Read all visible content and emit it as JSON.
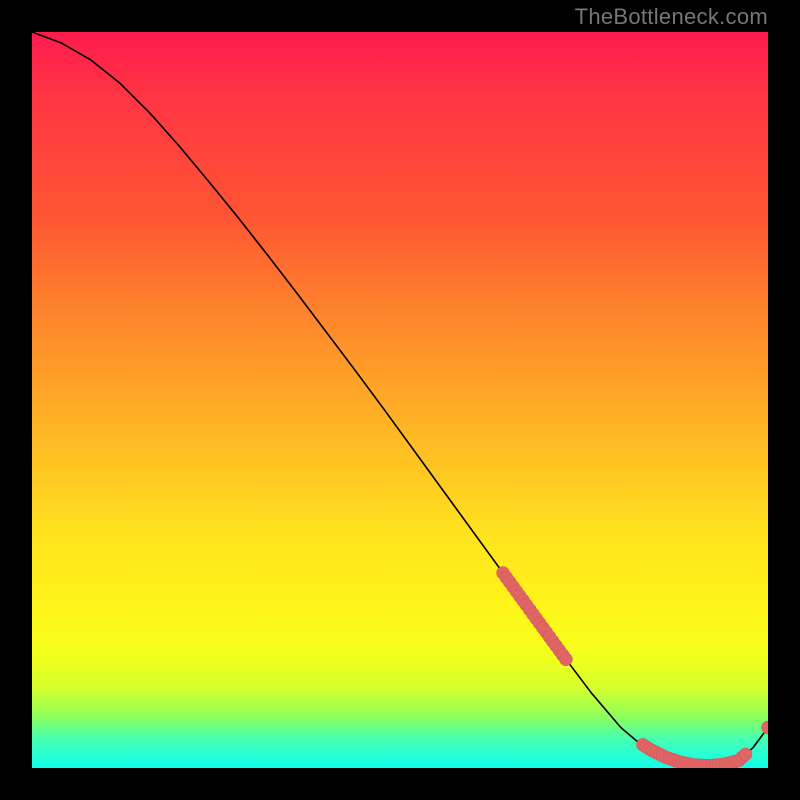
{
  "watermark": "TheBottleneck.com",
  "chart_data": {
    "type": "line",
    "title": "",
    "xlabel": "",
    "ylabel": "",
    "x_range": [
      0,
      100
    ],
    "y_range": [
      0,
      100
    ],
    "curve": {
      "name": "bottleneck-curve",
      "x": [
        0,
        4,
        8,
        12,
        16,
        20,
        24,
        28,
        32,
        36,
        40,
        44,
        48,
        52,
        56,
        60,
        64,
        68,
        72,
        76,
        80,
        82,
        84,
        86,
        88,
        90,
        92,
        94,
        96,
        98,
        100
      ],
      "y": [
        100,
        98.5,
        96.2,
        93.0,
        89.0,
        84.5,
        79.7,
        74.8,
        69.7,
        64.5,
        59.2,
        53.9,
        48.5,
        43.0,
        37.5,
        32.0,
        26.5,
        21.0,
        15.5,
        10.2,
        5.5,
        3.8,
        2.5,
        1.5,
        0.8,
        0.4,
        0.3,
        0.5,
        1.0,
        2.8,
        5.5
      ]
    },
    "highlight_regions": [
      {
        "name": "cluster-left",
        "x_start": 64,
        "x_end": 73,
        "y_approx": 22
      },
      {
        "name": "cluster-right",
        "x_start": 83,
        "x_end": 97,
        "y_approx": 1
      }
    ],
    "colors": {
      "curve": "#000000",
      "marker_fill": "#e06666",
      "marker_stroke": "#d05454"
    }
  }
}
